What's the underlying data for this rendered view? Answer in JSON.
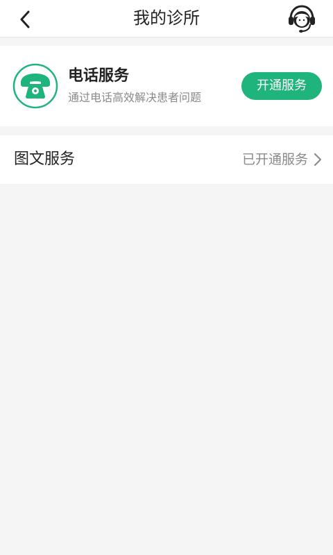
{
  "header": {
    "title": "我的诊所",
    "back_icon": "chevron-left-icon",
    "support_icon": "customer-service-headset-icon"
  },
  "phone_service": {
    "icon": "telephone-icon",
    "title": "电话服务",
    "description": "通过电话高效解决患者问题",
    "button_label": "开通服务",
    "accent_color": "#1fb47c"
  },
  "image_text_service": {
    "title": "图文服务",
    "status": "已开通服务",
    "arrow_icon": "chevron-right-icon"
  }
}
